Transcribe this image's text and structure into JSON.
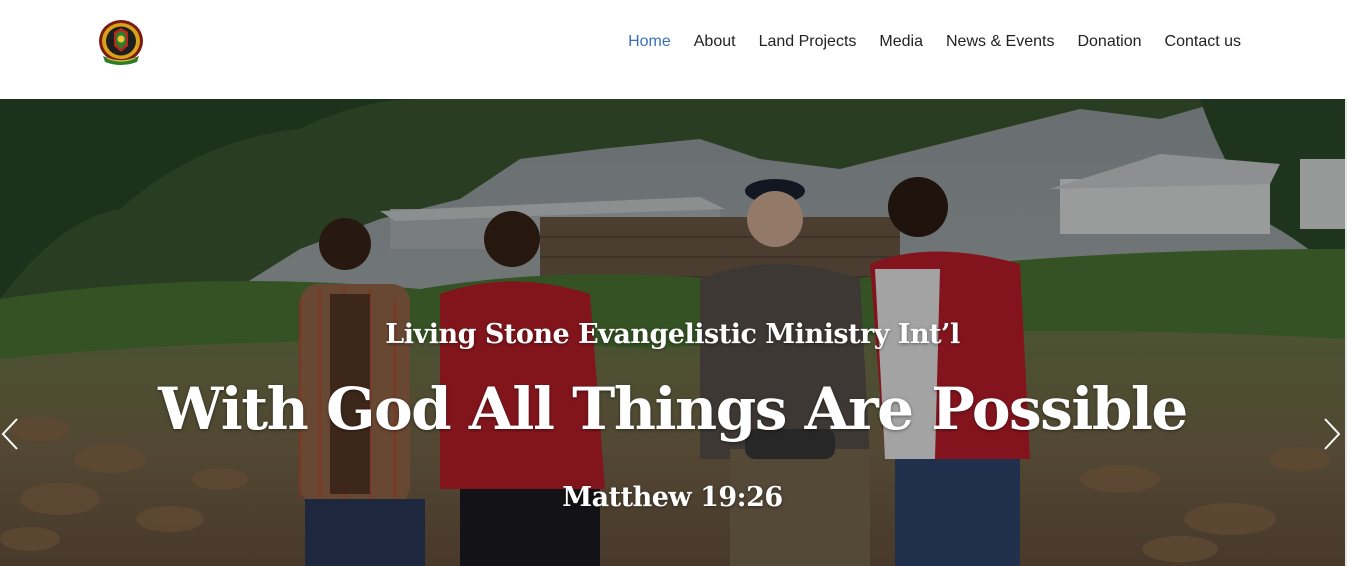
{
  "nav": {
    "items": [
      {
        "label": "Home",
        "active": true
      },
      {
        "label": "About",
        "active": false
      },
      {
        "label": "Land Projects",
        "active": false
      },
      {
        "label": "Media",
        "active": false
      },
      {
        "label": "News & Events",
        "active": false
      },
      {
        "label": "Donation",
        "active": false
      },
      {
        "label": "Contact us",
        "active": false
      }
    ],
    "active_color": "#3a6fb6"
  },
  "hero": {
    "subtitle": "Living Stone Evangelistic Ministry Int’l",
    "title": "With God All Things Are Possible",
    "verse": "Matthew 19:26",
    "prev_icon": "chevron-left-icon",
    "next_icon": "chevron-right-icon"
  },
  "logo": {
    "icon": "ministry-crest-logo"
  }
}
